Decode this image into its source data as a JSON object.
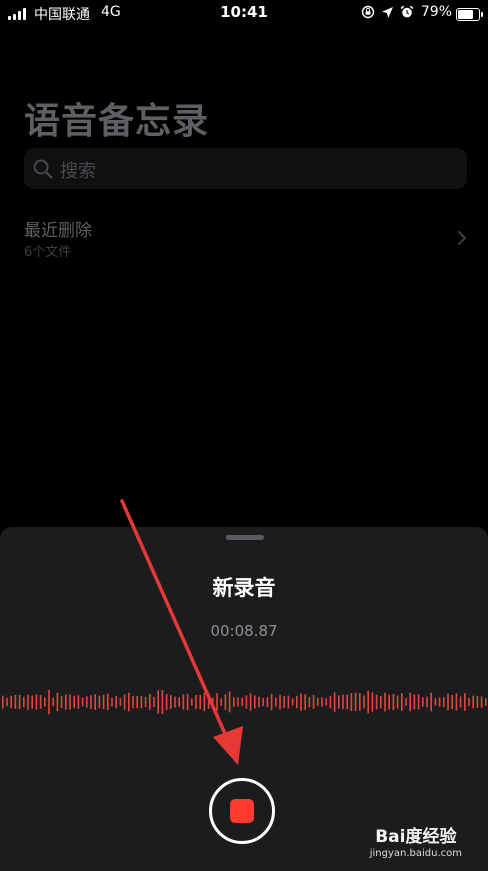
{
  "status_bar": {
    "carrier": "中国联通",
    "network": "4G",
    "time": "10:41",
    "battery_percent": "79%",
    "battery_level": 0.79,
    "icons": [
      "orientation-lock-icon",
      "location-arrow-icon",
      "alarm-icon"
    ]
  },
  "main": {
    "title": "语音备忘录",
    "search": {
      "placeholder": "搜索"
    },
    "folder": {
      "name": "最近删除",
      "count": "6个文件"
    }
  },
  "recording": {
    "title": "新录音",
    "elapsed": "00:08.87"
  },
  "colors": {
    "accent_red": "#ff3b30",
    "sheet_background": "#1c1c1e",
    "waveform": "#e2473f",
    "annotation_arrow": "#e53935"
  },
  "watermark": {
    "logo": "Bai度经验",
    "url": "jingyan.baidu.com"
  }
}
